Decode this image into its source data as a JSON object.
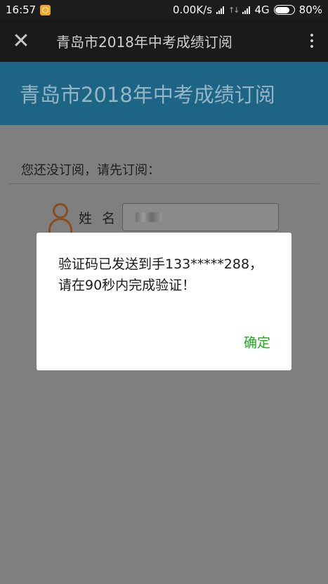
{
  "status_bar": {
    "time": "16:57",
    "network_speed": "0.00K/s",
    "network_type": "4G",
    "battery": "80%"
  },
  "title_bar": {
    "title": "青岛市2018年中考成绩订阅"
  },
  "banner": {
    "title": "青岛市2018年中考成绩订阅"
  },
  "form": {
    "prompt": "您还没订阅，请先订阅：",
    "name_label": "姓 名"
  },
  "dialog": {
    "line1": "验证码已发送到手133*****288，",
    "line2": "请在90秒内完成验证！",
    "confirm_label": "确定"
  },
  "colors": {
    "banner_bg": "#2fa0d0",
    "confirm_text": "#1aad19",
    "overlay": "#7f7f7f"
  }
}
